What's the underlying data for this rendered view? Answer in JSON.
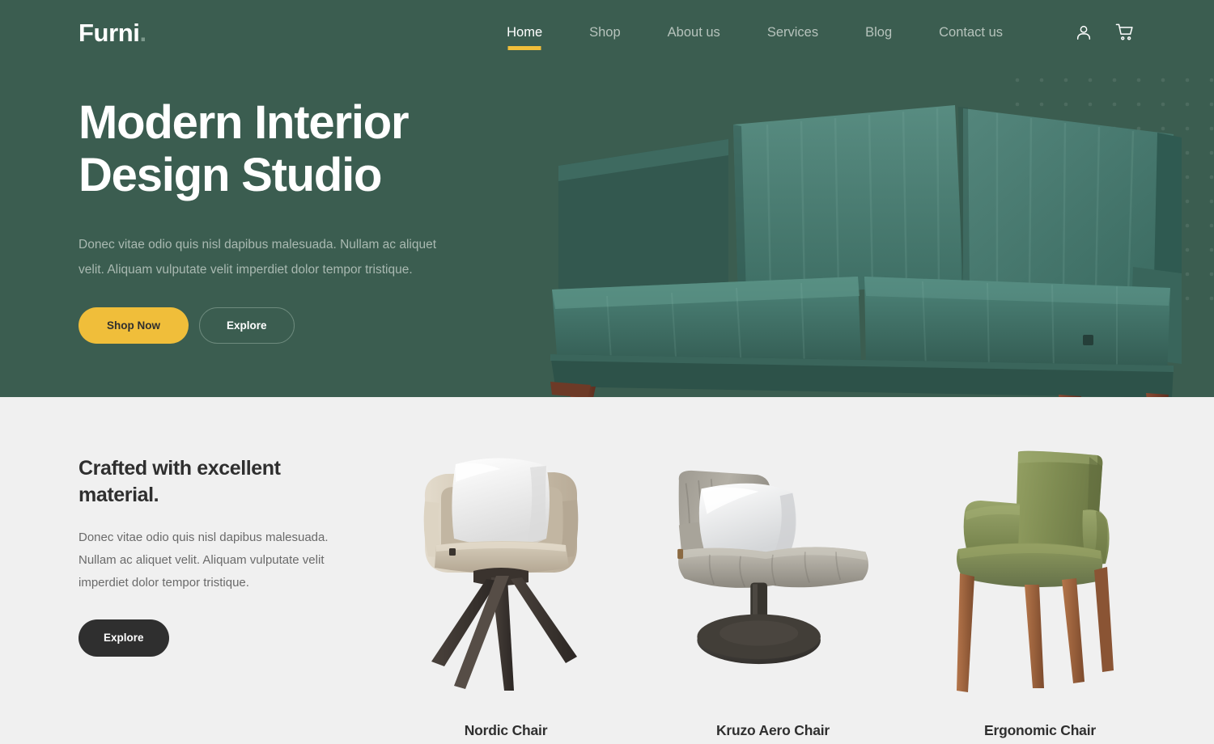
{
  "brand": {
    "name": "Furni",
    "accent_dot": "."
  },
  "colors": {
    "hero_background": "#3b5d50",
    "page_background": "#f0f0f0",
    "accent_yellow": "#f0be3a",
    "dark_button": "#2f2f2f",
    "heading_text": "#2f2f2f",
    "muted_text": "#6a6a6a",
    "hero_muted_text": "#a9b9b1",
    "dot_pattern": "#4c6b5f"
  },
  "nav": {
    "items": [
      {
        "label": "Home",
        "active": true
      },
      {
        "label": "Shop",
        "active": false
      },
      {
        "label": "About us",
        "active": false
      },
      {
        "label": "Services",
        "active": false
      },
      {
        "label": "Blog",
        "active": false
      },
      {
        "label": "Contact us",
        "active": false
      }
    ],
    "icons": [
      {
        "name": "user-account-icon"
      },
      {
        "name": "shopping-cart-icon"
      }
    ]
  },
  "hero": {
    "title_line1": "Modern Interior",
    "title_line2": "Design Studio",
    "paragraph": "Donec vitae odio quis nisl dapibus malesuada. Nullam ac aliquet velit. Aliquam vulputate velit imperdiet dolor tempor tristique.",
    "primary_button": "Shop Now",
    "secondary_button": "Explore",
    "image_alt": "green-velvet-sofa"
  },
  "features": {
    "title": "Crafted with excellent material.",
    "paragraph": "Donec vitae odio quis nisl dapibus malesuada. Nullam ac aliquet velit. Aliquam vulputate velit imperdiet dolor tempor tristique.",
    "button": "Explore",
    "products": [
      {
        "name": "Nordic Chair",
        "image_alt": "beige-armchair-with-white-pillow"
      },
      {
        "name": "Kruzo Aero Chair",
        "image_alt": "grey-lounge-chair-pedestal-base"
      },
      {
        "name": "Ergonomic Chair",
        "image_alt": "olive-green-armchair-wooden-legs"
      }
    ]
  }
}
